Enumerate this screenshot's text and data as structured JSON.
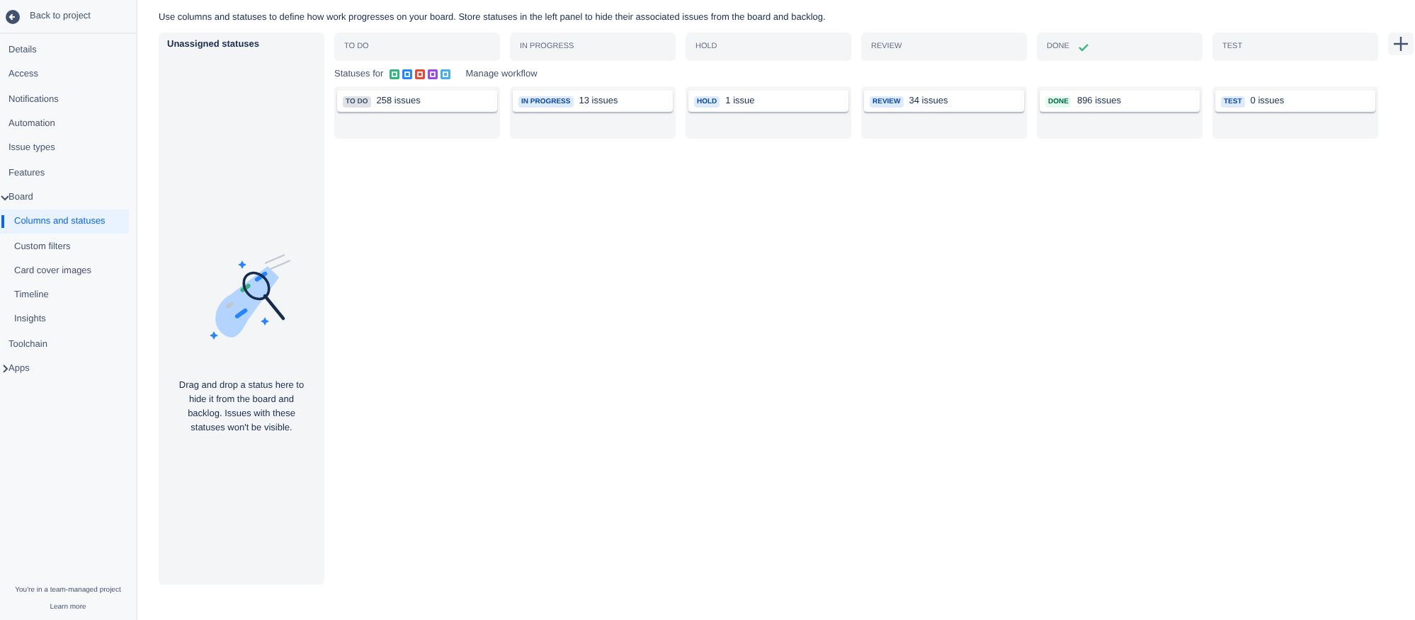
{
  "sidebar": {
    "back": "Back to project",
    "items": [
      {
        "label": "Details",
        "selected": false
      },
      {
        "label": "Access",
        "selected": false
      },
      {
        "label": "Notifications",
        "selected": false
      },
      {
        "label": "Automation",
        "selected": false
      },
      {
        "label": "Issue types",
        "selected": false
      },
      {
        "label": "Features",
        "selected": false
      },
      {
        "label": "Board",
        "selected": false,
        "expanded": true,
        "children": [
          {
            "label": "Columns and statuses",
            "selected": true
          },
          {
            "label": "Custom filters",
            "selected": false
          },
          {
            "label": "Card cover images",
            "selected": false
          },
          {
            "label": "Timeline",
            "selected": false
          },
          {
            "label": "Insights",
            "selected": false
          }
        ]
      },
      {
        "label": "Toolchain",
        "selected": false
      },
      {
        "label": "Apps",
        "selected": false,
        "expanded": false
      }
    ],
    "footer": "You're in a team-managed project",
    "footer_link": "Learn more"
  },
  "description": "Use columns and statuses to define how work progresses on your board. Store statuses in the left panel to hide their associated issues from the board and backlog.",
  "unassigned": {
    "title": "Unassigned statuses",
    "hint": "Drag and drop a status here to hide it from the board and backlog. Issues with these statuses won't be visible."
  },
  "statuses_for": {
    "label": "Statuses for",
    "issue_types": [
      {
        "color": "#36b37e"
      },
      {
        "color": "#2684ff"
      },
      {
        "color": "#e5493a"
      },
      {
        "color": "#904ee2"
      },
      {
        "color": "#4bade8"
      }
    ],
    "link": "Manage workflow"
  },
  "columns": [
    {
      "name": "TO DO",
      "done": false,
      "status": {
        "label": "TO DO",
        "kind": "todo",
        "count": "258 issues"
      }
    },
    {
      "name": "IN PROGRESS",
      "done": false,
      "status": {
        "label": "IN PROGRESS",
        "kind": "inprogress",
        "count": "13 issues"
      }
    },
    {
      "name": "HOLD",
      "done": false,
      "status": {
        "label": "HOLD",
        "kind": "inprogress",
        "count": "1 issue"
      }
    },
    {
      "name": "REVIEW",
      "done": false,
      "status": {
        "label": "REVIEW",
        "kind": "inprogress",
        "count": "34 issues"
      }
    },
    {
      "name": "DONE",
      "done": true,
      "status": {
        "label": "DONE",
        "kind": "done",
        "count": "896 issues"
      }
    },
    {
      "name": "TEST",
      "done": false,
      "status": {
        "label": "TEST",
        "kind": "inprogress",
        "count": "0 issues"
      }
    }
  ]
}
